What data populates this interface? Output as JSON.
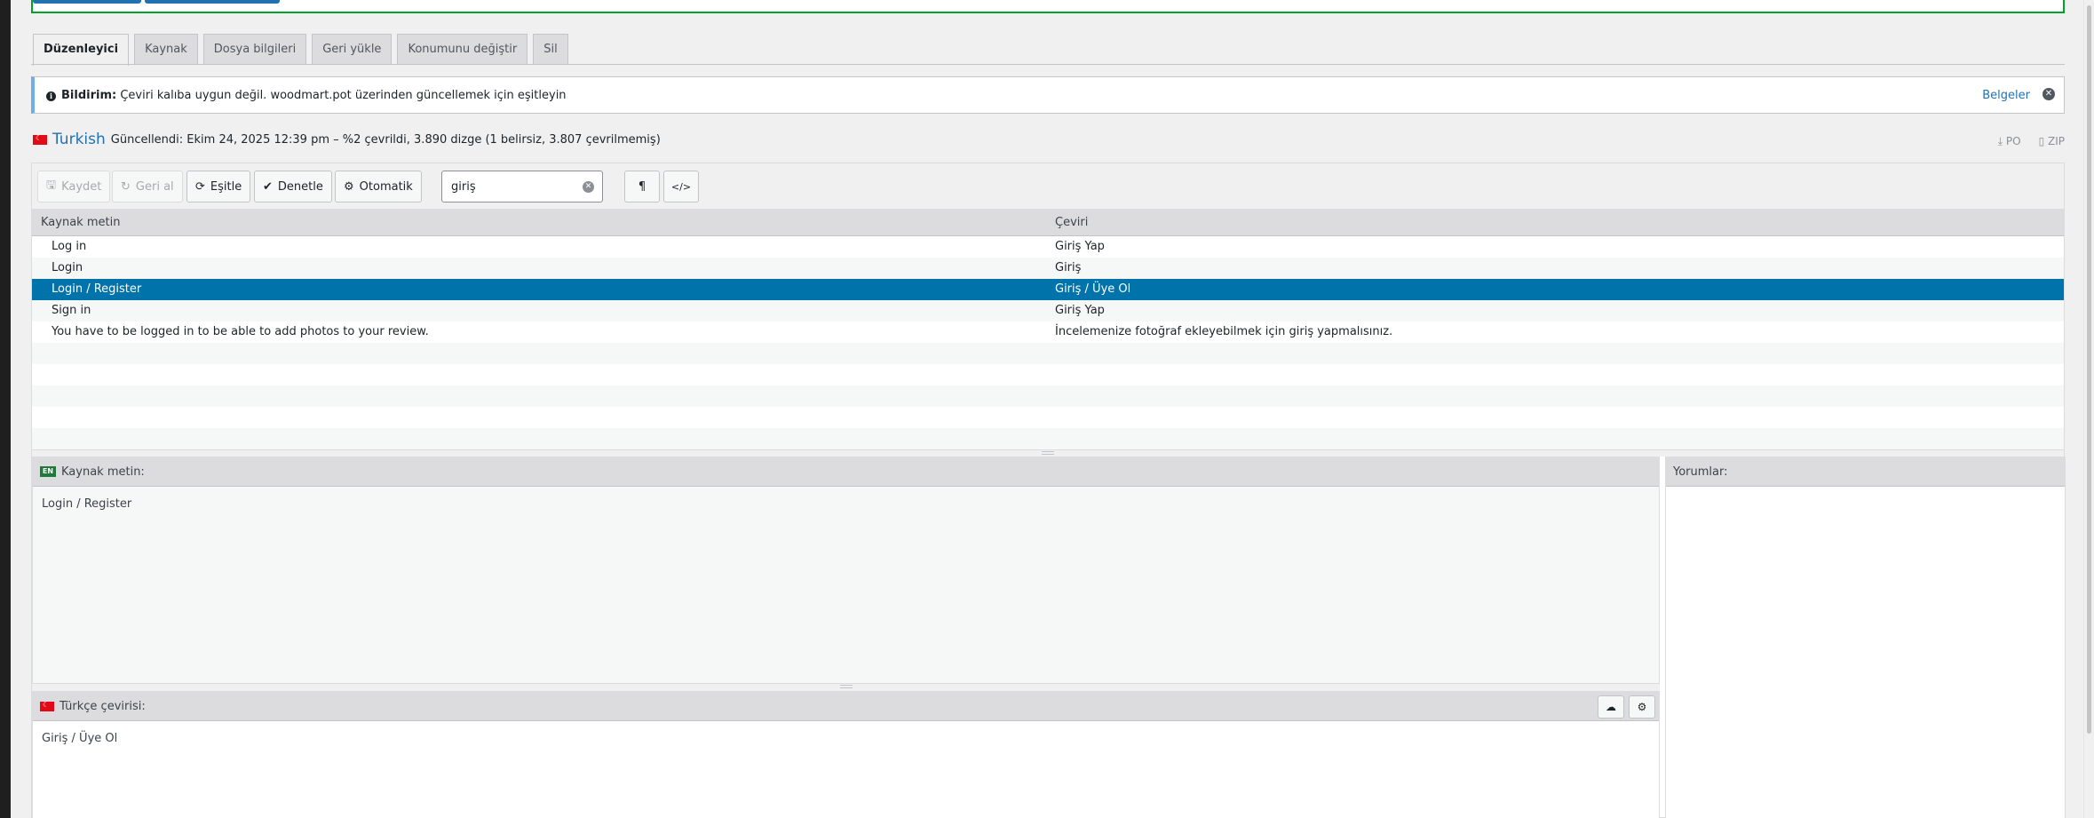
{
  "tabs": [
    {
      "label": "Düzenleyici",
      "active": true
    },
    {
      "label": "Kaynak"
    },
    {
      "label": "Dosya bilgileri"
    },
    {
      "label": "Geri yükle"
    },
    {
      "label": "Konumunu değiştir"
    },
    {
      "label": "Sil"
    }
  ],
  "notice": {
    "title": "Bildirim:",
    "message": "Çeviri kalıba uygun değil. woodmart.pot üzerinden güncellemek için eşitleyin",
    "docs_link": "Belgeler"
  },
  "language": {
    "name": "Turkish",
    "meta": "Güncellendi: Ekim 24, 2025 12:39 pm – %2 çevrildi, 3.890 dizge (1 belirsiz, 3.807 çevrilmemiş)",
    "download_po": "PO",
    "download_zip": "ZIP"
  },
  "toolbar": {
    "save": "Kaydet",
    "revert": "Geri al",
    "sync": "Eşitle",
    "check": "Denetle",
    "auto": "Otomatik",
    "search_value": "giriş",
    "pilcrow": "¶",
    "code": "</>"
  },
  "list": {
    "col_source": "Kaynak metin",
    "col_translation": "Çeviri",
    "rows": [
      {
        "source": "Log in",
        "translation": "Giriş Yap"
      },
      {
        "source": "Login",
        "translation": "Giriş"
      },
      {
        "source": "Login / Register",
        "translation": "Giriş / Üye Ol",
        "selected": true
      },
      {
        "source": "Sign in",
        "translation": "Giriş Yap"
      },
      {
        "source": "You have to be logged in to be able to add photos to your review.",
        "translation": "İncelemenize fotoğraf ekleyebilmek için giriş yapmalısınız."
      }
    ]
  },
  "source_pane": {
    "flag": "EN",
    "title": "Kaynak metin:",
    "text": "Login / Register"
  },
  "comments_pane": {
    "title": "Yorumlar:"
  },
  "translation_pane": {
    "title": "Türkçe çevirisi:",
    "text": "Giriş / Üye Ol"
  },
  "colors": {
    "selected_row": "#0073aa",
    "link": "#2271b1",
    "notice_border": "#72aee6",
    "success_border": "#00a32a"
  }
}
